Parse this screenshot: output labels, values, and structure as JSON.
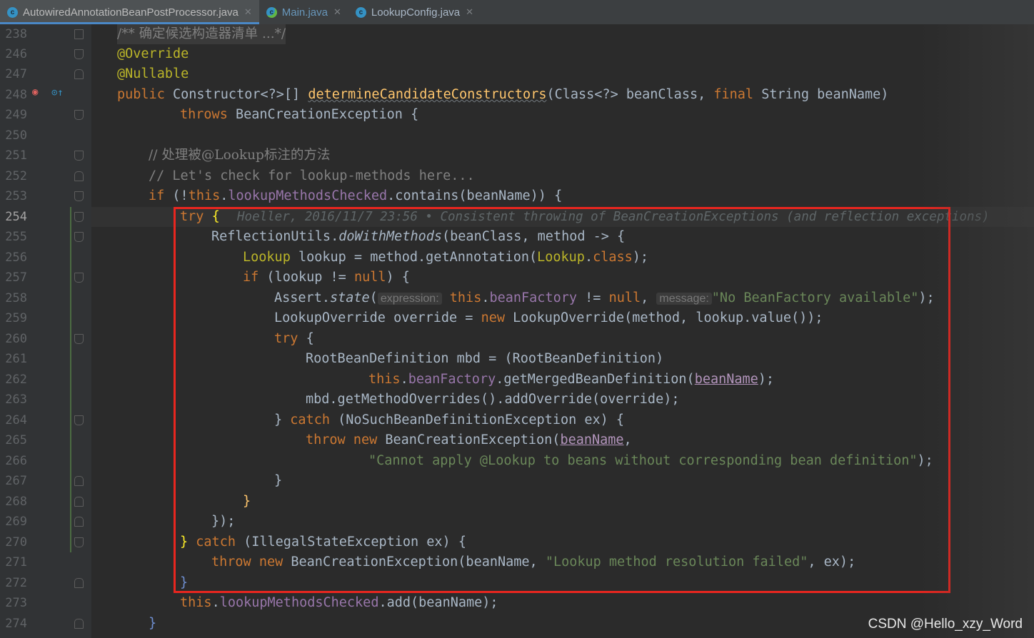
{
  "tabs": [
    {
      "label": "AutowiredAnnotationBeanPostProcessor.java",
      "icon": "class-icon",
      "active": true
    },
    {
      "label": "Main.java",
      "icon": "run-class-icon",
      "active": false
    },
    {
      "label": "LookupConfig.java",
      "icon": "class-icon",
      "active": false
    }
  ],
  "lines": {
    "l238": {
      "num": "238",
      "text": "/** 确定候选构造器清单 ...*/"
    },
    "l246": {
      "num": "246",
      "text": "@Override"
    },
    "l247": {
      "num": "247",
      "text": "@Nullable"
    },
    "l248": {
      "num": "248",
      "kw": "public ",
      "t1": "Constructor<?>[] ",
      "fn": "determineCandidateConstructors",
      "t2": "(Class<?> beanClass, ",
      "kw2": "final ",
      "t3": "String beanName)"
    },
    "l249": {
      "num": "249",
      "kw": "throws ",
      "t1": "BeanCreationException {"
    },
    "l250": {
      "num": "250"
    },
    "l251": {
      "num": "251",
      "text": "// 处理被@Lookup标注的方法"
    },
    "l252": {
      "num": "252",
      "text": "// Let's check for lookup-methods here..."
    },
    "l253": {
      "num": "253",
      "kw": "if ",
      "t1": "(!",
      "kw2": "this",
      "t2": ".",
      "fd": "lookupMethodsChecked",
      "t3": ".contains(beanName)) {"
    },
    "l254": {
      "num": "254",
      "kw": "try ",
      "t1": "{",
      "blame": "Hoeller, 2016/11/7 23:56 • Consistent throwing of BeanCreationExceptions (and reflection exceptions)"
    },
    "l255": {
      "num": "255",
      "t1": "ReflectionUtils.",
      "it": "doWithMethods",
      "t2": "(beanClass, method -> {"
    },
    "l256": {
      "num": "256",
      "an": "Lookup",
      "t1": " lookup = method.getAnnotation(",
      "an2": "Lookup",
      "t2": ".",
      "kw": "class",
      "t3": ");"
    },
    "l257": {
      "num": "257",
      "kw": "if ",
      "t1": "(lookup != ",
      "kw2": "null",
      "t2": ") {"
    },
    "l258": {
      "num": "258",
      "t1": "Assert.",
      "it": "state",
      "t2": "(",
      "hint1": "expression:",
      "kw": "this",
      "t3": ".",
      "fd": "beanFactory",
      "t4": " != ",
      "kw2": "null",
      "t5": ", ",
      "hint2": "message:",
      "st": "\"No BeanFactory available\"",
      "t6": ");"
    },
    "l259": {
      "num": "259",
      "t1": "LookupOverride override = ",
      "kw": "new ",
      "t2": "LookupOverride(method, lookup.value());"
    },
    "l260": {
      "num": "260",
      "kw": "try ",
      "t1": "{"
    },
    "l261": {
      "num": "261",
      "t1": "RootBeanDefinition mbd = (RootBeanDefinition)"
    },
    "l262": {
      "num": "262",
      "kw": "this",
      "t1": ".",
      "fd": "beanFactory",
      "t2": ".getMergedBeanDefinition(",
      "ul": "beanName",
      "t3": ");"
    },
    "l263": {
      "num": "263",
      "t1": "mbd.getMethodOverrides().addOverride(override);"
    },
    "l264": {
      "num": "264",
      "t1": "} ",
      "kw": "catch ",
      "t2": "(NoSuchBeanDefinitionException ex) {"
    },
    "l265": {
      "num": "265",
      "kw": "throw new ",
      "t1": "BeanCreationException(",
      "ul": "beanName",
      "t2": ","
    },
    "l266": {
      "num": "266",
      "st": "\"Cannot apply @Lookup to beans without corresponding bean definition\"",
      "t1": ");"
    },
    "l267": {
      "num": "267",
      "t1": "}"
    },
    "l268": {
      "num": "268",
      "t1": "}"
    },
    "l269": {
      "num": "269",
      "t1": "});"
    },
    "l270": {
      "num": "270",
      "t1": "} ",
      "kw": "catch ",
      "t2": "(IllegalStateException ex) {"
    },
    "l271": {
      "num": "271",
      "kw": "throw new ",
      "t1": "BeanCreationException(beanName, ",
      "st": "\"Lookup method resolution failed\"",
      "t2": ", ex);"
    },
    "l272": {
      "num": "272",
      "t1": "}"
    },
    "l273": {
      "num": "273",
      "kw": "this",
      "t1": ".",
      "fd": "lookupMethodsChecked",
      "t2": ".add(beanName);"
    },
    "l274": {
      "num": "274",
      "t1": "}"
    }
  },
  "watermark": "CSDN @Hello_xzy_Word",
  "colors": {
    "keyword": "#cc7832",
    "annotation": "#bbb529",
    "string": "#6a8759",
    "field": "#9876aa",
    "highlight_box": "#e8261f"
  }
}
